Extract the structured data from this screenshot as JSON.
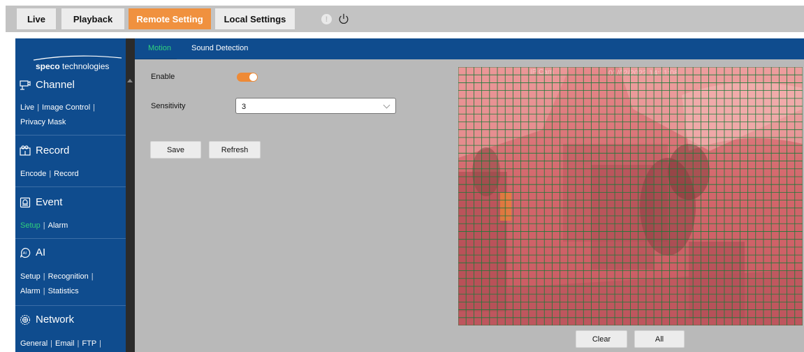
{
  "top_tabs": {
    "live": "Live",
    "playback": "Playback",
    "remote_setting": "Remote Setting",
    "local_settings": "Local Settings"
  },
  "alert_icon_glyph": "!",
  "logo": {
    "brand": "speco",
    "suffix": " technologies"
  },
  "sidebar": {
    "channel": {
      "title": "Channel",
      "links": [
        "Live",
        "Image Control",
        "Privacy Mask"
      ]
    },
    "record": {
      "title": "Record",
      "links": [
        "Encode",
        "Record"
      ]
    },
    "event": {
      "title": "Event",
      "links": [
        "Setup",
        "Alarm"
      ],
      "active": "Setup"
    },
    "ai": {
      "title": "AI",
      "links": [
        "Setup",
        "Recognition",
        "Alarm",
        "Statistics"
      ]
    },
    "network": {
      "title": "Network",
      "links": [
        "General",
        "Email",
        "FTP"
      ]
    }
  },
  "main_tabs": {
    "motion": "Motion",
    "sound_detection": "Sound Detection",
    "active": "Motion"
  },
  "form": {
    "enable_label": "Enable",
    "enable_value": true,
    "sensitivity_label": "Sensitivity",
    "sensitivity_value": "3",
    "save_label": "Save",
    "refresh_label": "Refresh"
  },
  "video": {
    "camera_name": "IP Cam",
    "timestamp": "01/02/2022 14:11:08",
    "grid_cols": 44,
    "grid_rows": 33
  },
  "grid_buttons": {
    "clear_label": "Clear",
    "all_label": "All"
  },
  "colors": {
    "accent_orange": "#f0913f",
    "nav_blue": "#0f4c8e",
    "active_green": "#30d27d",
    "motion_overlay": "#e34b55",
    "grid_line": "#1b7a3a"
  }
}
